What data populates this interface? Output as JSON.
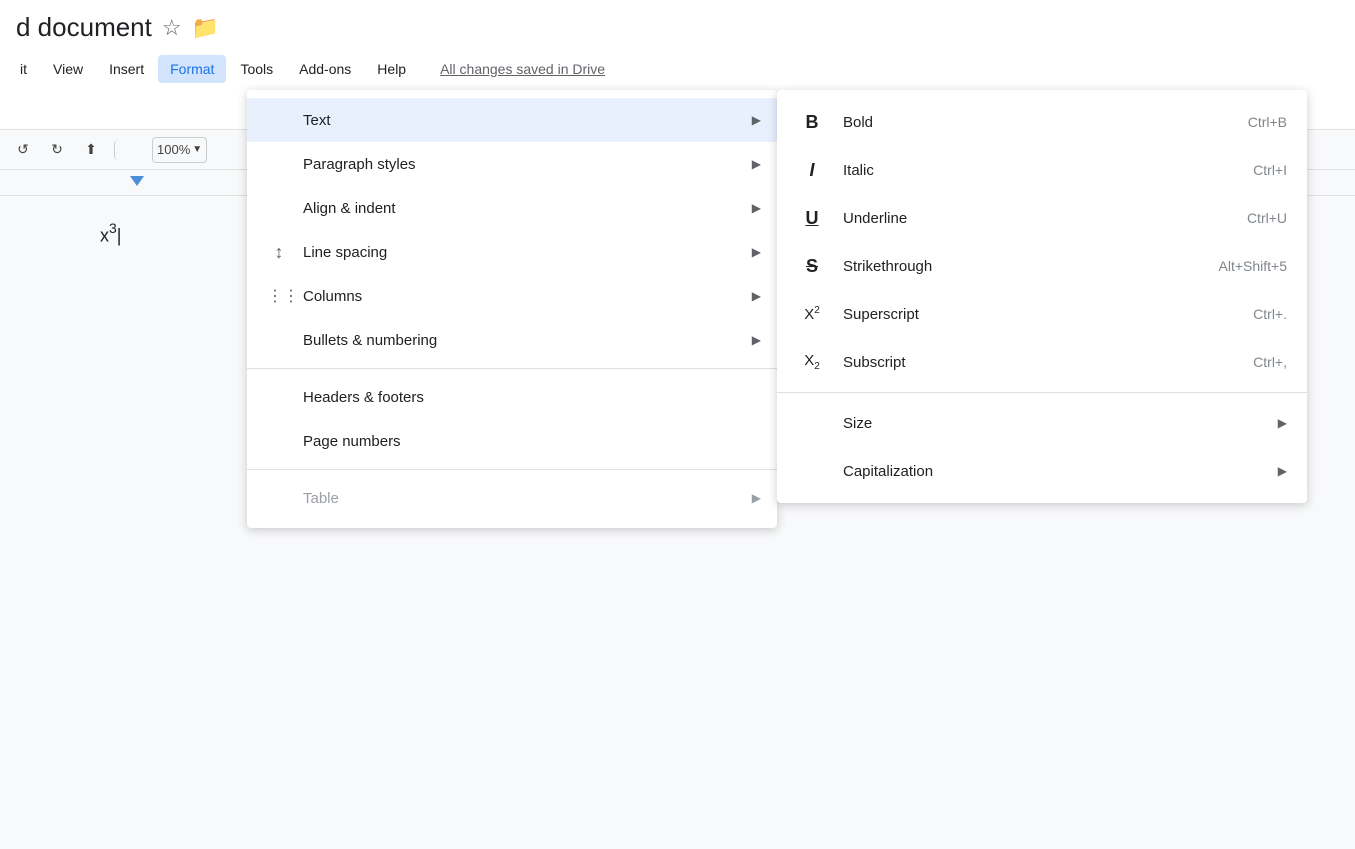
{
  "title": {
    "doc_name": "d document",
    "star": "☆",
    "folder": "📁"
  },
  "menubar": {
    "items": [
      "it",
      "View",
      "Insert",
      "Format",
      "Tools",
      "Add-ons",
      "Help"
    ],
    "active": "Format",
    "saved_text": "All changes saved in Drive"
  },
  "toolbar": {
    "zoom": "100%",
    "zoom_arrow": "▼"
  },
  "format_menu": {
    "items": [
      {
        "label": "Text",
        "icon": "",
        "has_arrow": true,
        "highlighted": true,
        "disabled": false
      },
      {
        "label": "Paragraph styles",
        "icon": "",
        "has_arrow": true,
        "highlighted": false,
        "disabled": false
      },
      {
        "label": "Align & indent",
        "icon": "",
        "has_arrow": true,
        "highlighted": false,
        "disabled": false
      },
      {
        "label": "Line spacing",
        "icon": "line_spacing",
        "has_arrow": true,
        "highlighted": false,
        "disabled": false
      },
      {
        "label": "Columns",
        "icon": "columns",
        "has_arrow": true,
        "highlighted": false,
        "disabled": false
      },
      {
        "label": "Bullets & numbering",
        "icon": "",
        "has_arrow": true,
        "highlighted": false,
        "disabled": false
      },
      {
        "divider": true
      },
      {
        "label": "Headers & footers",
        "icon": "",
        "has_arrow": false,
        "highlighted": false,
        "disabled": false
      },
      {
        "label": "Page numbers",
        "icon": "",
        "has_arrow": false,
        "highlighted": false,
        "disabled": false
      },
      {
        "divider": true
      },
      {
        "label": "Table",
        "icon": "",
        "has_arrow": true,
        "highlighted": false,
        "disabled": true
      }
    ]
  },
  "text_submenu": {
    "items": [
      {
        "label": "Bold",
        "icon_type": "bold",
        "icon_char": "B",
        "shortcut": "Ctrl+B"
      },
      {
        "label": "Italic",
        "icon_type": "italic",
        "icon_char": "I",
        "shortcut": "Ctrl+I"
      },
      {
        "label": "Underline",
        "icon_type": "underline",
        "icon_char": "U",
        "shortcut": "Ctrl+U"
      },
      {
        "label": "Strikethrough",
        "icon_type": "strike",
        "icon_char": "S",
        "shortcut": "Alt+Shift+5"
      },
      {
        "label": "Superscript",
        "icon_type": "superscript",
        "icon_char": "X²",
        "shortcut": "Ctrl+."
      },
      {
        "label": "Subscript",
        "icon_type": "subscript",
        "icon_char": "X₂",
        "shortcut": "Ctrl+,"
      },
      {
        "divider": true
      },
      {
        "label": "Size",
        "icon_type": "",
        "icon_char": "",
        "shortcut": "",
        "has_arrow": true
      },
      {
        "label": "Capitalization",
        "icon_type": "",
        "icon_char": "",
        "shortcut": "",
        "has_arrow": true
      }
    ]
  },
  "superscript_display": "x³|",
  "colors": {
    "active_menu_bg": "#d2e3fc",
    "highlighted_row": "#e8f0fe",
    "accent": "#1a73e8"
  }
}
